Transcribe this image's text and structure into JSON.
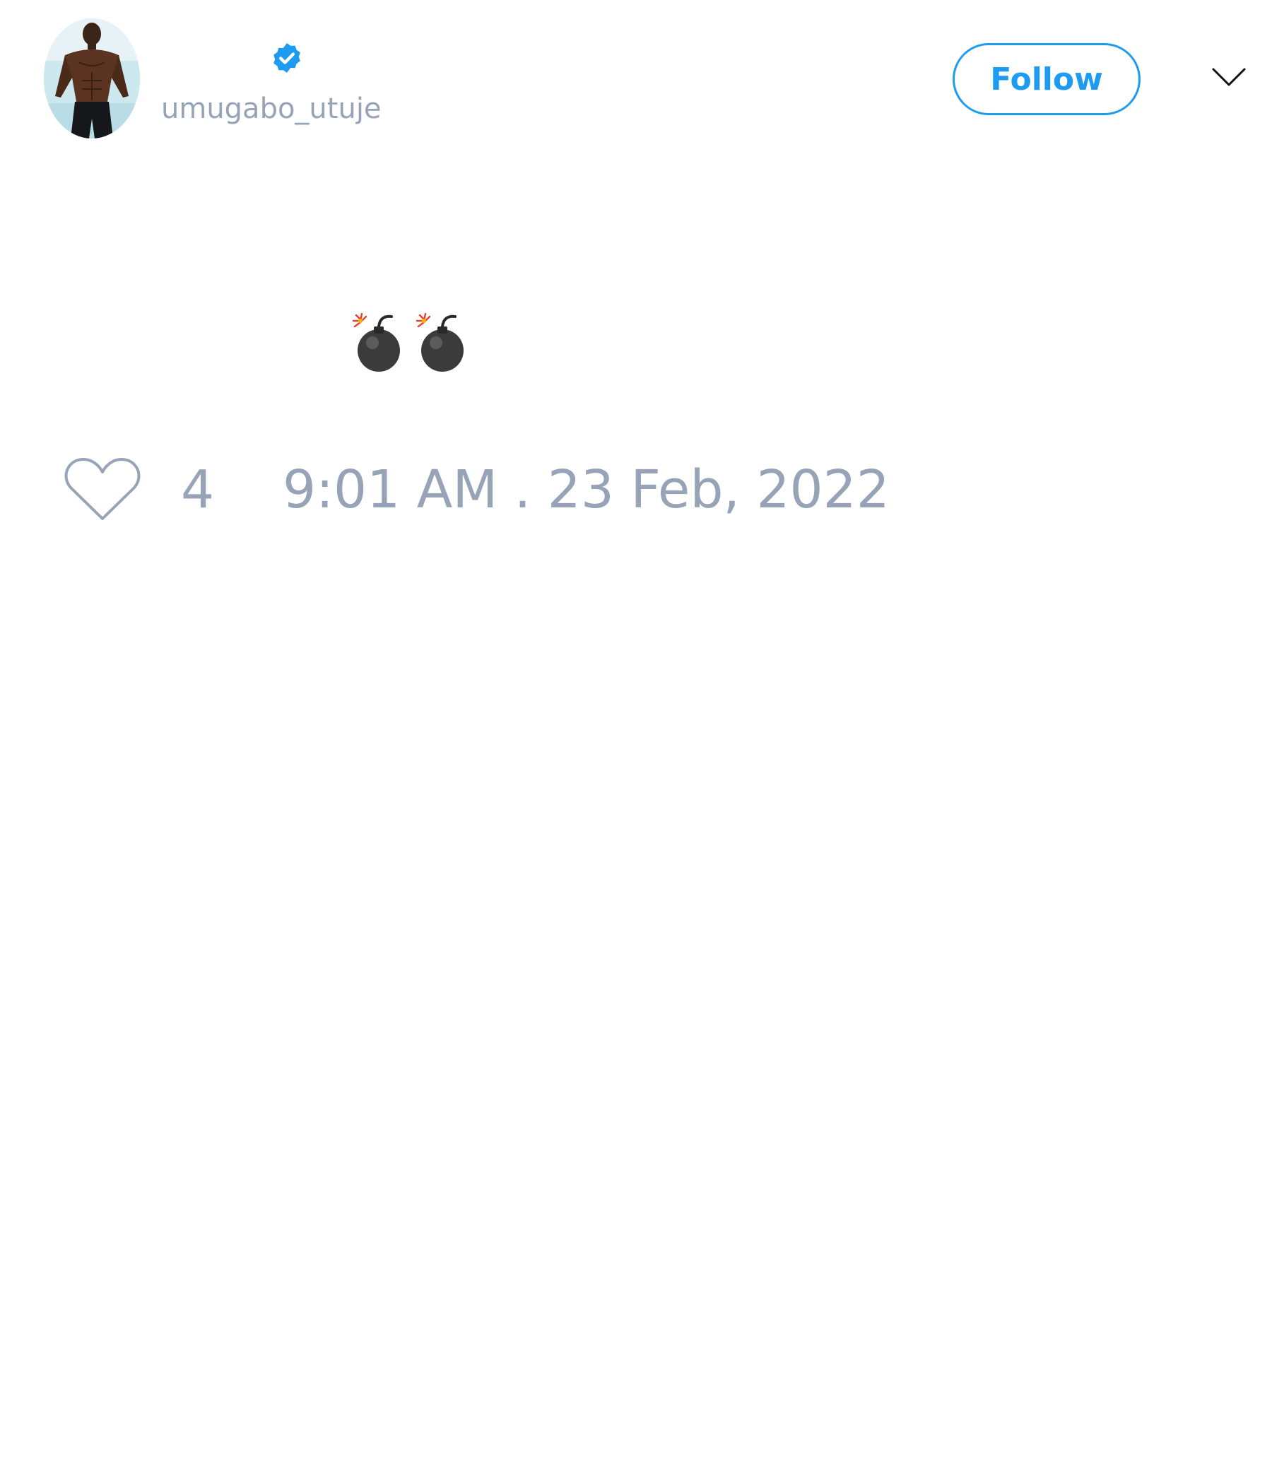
{
  "tweet": {
    "author": {
      "handle": "umugabo_utuje",
      "verified": true,
      "avatar": "avatar-photo"
    },
    "follow_label": "Follow",
    "text_icons": [
      "bomb-emoji",
      "bomb-emoji"
    ],
    "likes": "4",
    "timestamp": "9:01 AM . 23 Feb, 2022"
  },
  "colors": {
    "accent": "#1d9bf0",
    "muted_text": "#97a3b6",
    "background": "#ffffff"
  },
  "icons": {
    "verified": "verified-badge-icon",
    "menu": "chevron-down-icon",
    "like": "heart-outline-icon"
  }
}
